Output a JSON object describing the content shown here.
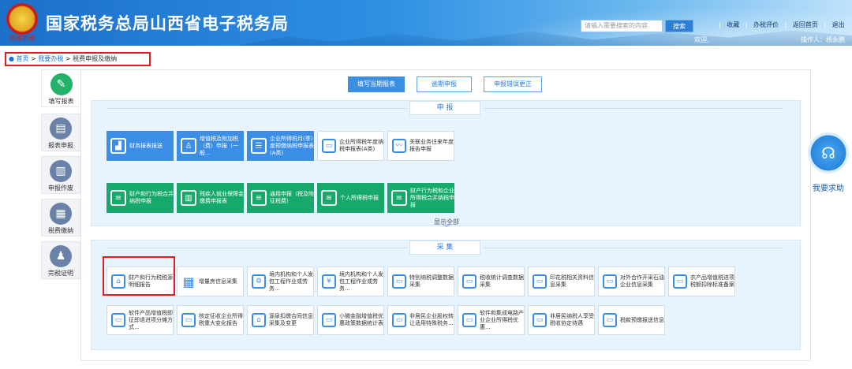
{
  "header": {
    "emblem_text": "国税地税",
    "title": "国家税务总局山西省电子税务局",
    "search_placeholder": "请输入需要搜索的内容",
    "search_button": "搜索",
    "links": [
      "收藏",
      "办税评价",
      "返回首页",
      "退出"
    ],
    "welcome": "欢迎,",
    "operator": "操作人：杨永鹏"
  },
  "breadcrumb": {
    "home": "首页",
    "level1": "我要办税",
    "current": "税费申报及缴纳",
    "sep": ">"
  },
  "leftnav": {
    "items": [
      {
        "label": "填写报表",
        "icon": "pencil-icon",
        "color": "#22b26a"
      },
      {
        "label": "报表申报",
        "icon": "report-icon",
        "color": "#6a82a8"
      },
      {
        "label": "申报作废",
        "icon": "cancel-report-icon",
        "color": "#6a82a8"
      },
      {
        "label": "税费缴纳",
        "icon": "payment-icon",
        "color": "#6a82a8"
      },
      {
        "label": "完税证明",
        "icon": "certificate-icon",
        "color": "#6a82a8"
      }
    ]
  },
  "tabs": {
    "fill": "填写当期报表",
    "overdue": "逾期申报",
    "correct": "申报错误更正"
  },
  "declare": {
    "title": "申 报",
    "row1": [
      {
        "label": "财务报表报送",
        "icon": "chart-icon"
      },
      {
        "label": "增值税及附加税（费）申报（一般...",
        "icon": "user-doc-icon"
      },
      {
        "label": "企业所得税月(季)度预缴纳税申报表(A类)",
        "icon": "list-icon"
      },
      {
        "label": "企业所得税年度纳税申报表(A类)",
        "icon": "monitor-icon"
      },
      {
        "label": "关联业务往来年度报告申报",
        "icon": "wave-icon"
      }
    ],
    "row2": [
      {
        "label": "财产和行为税合并纳税申报",
        "icon": "doc-icon"
      },
      {
        "label": "残疾人就业保障金缴费申报表",
        "icon": "books-icon"
      },
      {
        "label": "通用申报（税及附征税费）",
        "icon": "doc-icon"
      },
      {
        "label": "个人所得税申报",
        "icon": "doc-icon"
      },
      {
        "label": "财产行为税和企业所得税合并纳税申报",
        "icon": "doc-icon"
      }
    ],
    "show_all": "显示全部"
  },
  "collect": {
    "title": "采 集",
    "row1": [
      {
        "label": "财产和行为税税源明细报告",
        "icon": "house-doc-icon"
      },
      {
        "label": "增量房信息采集",
        "icon": "building-icon"
      },
      {
        "label": "境内机构和个人发包工程作业或劳务...",
        "icon": "doc-cog-icon"
      },
      {
        "label": "境内机构和个人发包工程作业或劳务...",
        "icon": "yuan-icon"
      },
      {
        "label": "特别纳税调整数据采集",
        "icon": "monitor-icon"
      },
      {
        "label": "税收统计调查数据采集",
        "icon": "monitor-icon"
      },
      {
        "label": "印花税相关资料信息采集",
        "icon": "monitor-icon"
      },
      {
        "label": "对外合作开采石油企业信息采集",
        "icon": "monitor-icon"
      },
      {
        "label": "农产品增值税进项税额扣除标准备案",
        "icon": "monitor-icon"
      }
    ],
    "row2": [
      {
        "label": "软件产品增值税即征即退进项分摊方式...",
        "icon": "monitor-icon"
      },
      {
        "label": "核定征收企业所得税重大变化报告",
        "icon": "monitor-icon"
      },
      {
        "label": "源泉扣缴合同信息采集及变更",
        "icon": "house-doc-icon"
      },
      {
        "label": "小微金融增值税优惠政策数据统计表",
        "icon": "monitor-icon"
      },
      {
        "label": "非居民企业股权转让适用特殊税务...",
        "icon": "monitor-icon"
      },
      {
        "label": "软件和集成电路产业企业所得税优惠...",
        "icon": "monitor-icon"
      },
      {
        "label": "非居民纳税人享受税收协定待遇",
        "icon": "monitor-icon"
      },
      {
        "label": "税款预缴报送信息",
        "icon": "monitor-icon"
      }
    ]
  },
  "help": {
    "label": "我要求助"
  }
}
